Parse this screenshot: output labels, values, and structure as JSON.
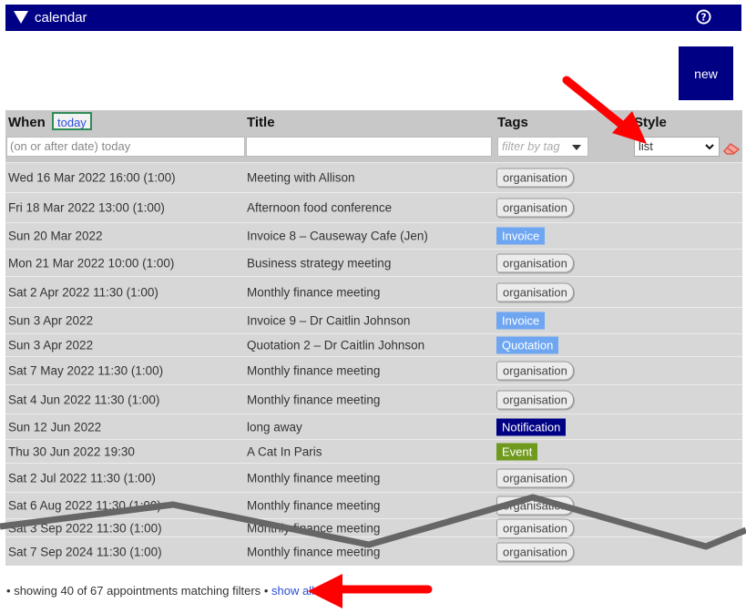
{
  "header": {
    "title": "calendar",
    "help_icon": "help-circle-icon",
    "toggle_icon": "triangle-down-icon"
  },
  "new_button": {
    "label": "new"
  },
  "table": {
    "columns": {
      "when": "When",
      "title": "Title",
      "tags": "Tags",
      "style": "Style"
    },
    "today_button": "today",
    "filters": {
      "when_value": "(on or after date) today",
      "title_value": "",
      "tags_placeholder": "filter by tag",
      "style_value": "list"
    },
    "rows": [
      {
        "when": "Wed 16 Mar 2022 16:00 (1:00)",
        "title": "Meeting with Allison",
        "tag": "organisation",
        "kind": "org"
      },
      {
        "when": "Fri 18 Mar 2022 13:00 (1:00)",
        "title": "Afternoon food conference",
        "tag": "organisation",
        "kind": "org"
      },
      {
        "when": "Sun 20 Mar 2022",
        "title": "Invoice 8 – Causeway Cafe (Jen)",
        "tag": "Invoice",
        "kind": "invoice"
      },
      {
        "when": "Mon 21 Mar 2022 10:00 (1:00)",
        "title": "Business strategy meeting",
        "tag": "organisation",
        "kind": "org"
      },
      {
        "when": "Sat 2 Apr 2022 11:30 (1:00)",
        "title": "Monthly finance meeting",
        "tag": "organisation",
        "kind": "org"
      },
      {
        "when": "Sun 3 Apr 2022",
        "title": "Invoice 9 – Dr Caitlin Johnson",
        "tag": "Invoice",
        "kind": "invoice"
      },
      {
        "when": "Sun 3 Apr 2022",
        "title": "Quotation 2 – Dr Caitlin Johnson",
        "tag": "Quotation",
        "kind": "quotation"
      },
      {
        "when": "Sat 7 May 2022 11:30 (1:00)",
        "title": "Monthly finance meeting",
        "tag": "organisation",
        "kind": "org"
      },
      {
        "when": "Sat 4 Jun 2022 11:30 (1:00)",
        "title": "Monthly finance meeting",
        "tag": "organisation",
        "kind": "org"
      },
      {
        "when": "Sun 12 Jun 2022",
        "title": "long away",
        "tag": "Notification",
        "kind": "notification"
      },
      {
        "when": "Thu 30 Jun 2022 19:30",
        "title": "A Cat In Paris",
        "tag": "Event",
        "kind": "event"
      },
      {
        "when": "Sat 2 Jul 2022 11:30 (1:00)",
        "title": "Monthly finance meeting",
        "tag": "organisation",
        "kind": "org"
      },
      {
        "when": "Sat 6 Aug 2022 11:30 (1:00)",
        "title": "Monthly finance meeting",
        "tag": "organisation",
        "kind": "org"
      },
      {
        "when": "Sat 3 Sep 2022 11:30 (1:00)",
        "title": "Monthly finance meeting",
        "tag": "organisation",
        "kind": "org"
      },
      {
        "when": "Sat 7 Sep 2024 11:30 (1:00)",
        "title": "Monthly finance meeting",
        "tag": "organisation",
        "kind": "org"
      }
    ]
  },
  "footer": {
    "bullet": "•",
    "summary": "showing 40 of 67 appointments matching filters",
    "link": "show all 67"
  },
  "colors": {
    "header_bg": "#000084",
    "arrow": "#ff0000",
    "break_line": "#666666"
  }
}
